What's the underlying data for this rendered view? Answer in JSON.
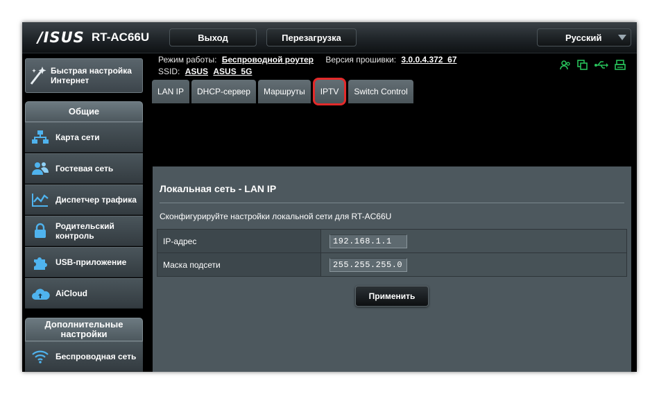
{
  "header": {
    "brand": "/ISUS",
    "model": "RT-AC66U",
    "logout_label": "Выход",
    "reboot_label": "Перезагрузка",
    "language": "Русский"
  },
  "info": {
    "mode_label": "Режим работы:",
    "mode_value": "Беспроводной роутер",
    "firmware_label": "Версия прошивки:",
    "firmware_value": "3.0.0.4.372_67",
    "ssid_label": "SSID:",
    "ssid_1": "ASUS",
    "ssid_2": "ASUS_5G"
  },
  "status_icons": [
    "users-icon",
    "copy-icon",
    "usb-icon",
    "printer-icon"
  ],
  "sidebar": {
    "quick_setup": "Быстрая настройка Интернет",
    "general_header": "Общие",
    "items": [
      {
        "label": "Карта сети",
        "icon": "network-map-icon"
      },
      {
        "label": "Гостевая сеть",
        "icon": "guest-network-icon"
      },
      {
        "label": "Диспетчер трафика",
        "icon": "traffic-manager-icon"
      },
      {
        "label": "Родительский контроль",
        "icon": "lock-icon"
      },
      {
        "label": "USB-приложение",
        "icon": "puzzle-icon"
      },
      {
        "label": "AiCloud",
        "icon": "cloud-icon"
      }
    ],
    "advanced_header": "Дополнительные настройки",
    "advanced_items": [
      {
        "label": "Беспроводная сеть",
        "icon": "wifi-icon"
      }
    ]
  },
  "tabs": [
    {
      "label": "LAN IP",
      "active": true
    },
    {
      "label": "DHCP-сервер",
      "active": false
    },
    {
      "label": "Маршруты",
      "active": false
    },
    {
      "label": "IPTV",
      "active": false,
      "highlighted": true
    },
    {
      "label": "Switch Control",
      "active": false
    }
  ],
  "main": {
    "title": "Локальная сеть - LAN IP",
    "description": "Сконфигурируйте настройки локальной сети для RT-AC66U",
    "fields": [
      {
        "label": "IP-адрес",
        "value": "192.168.1.1"
      },
      {
        "label": "Маска подсети",
        "value": "255.255.255.0"
      }
    ],
    "apply_label": "Применить"
  },
  "colors": {
    "accent_green": "#27c25a",
    "highlight_red": "#e32a2a",
    "panel": "#4d585e"
  }
}
